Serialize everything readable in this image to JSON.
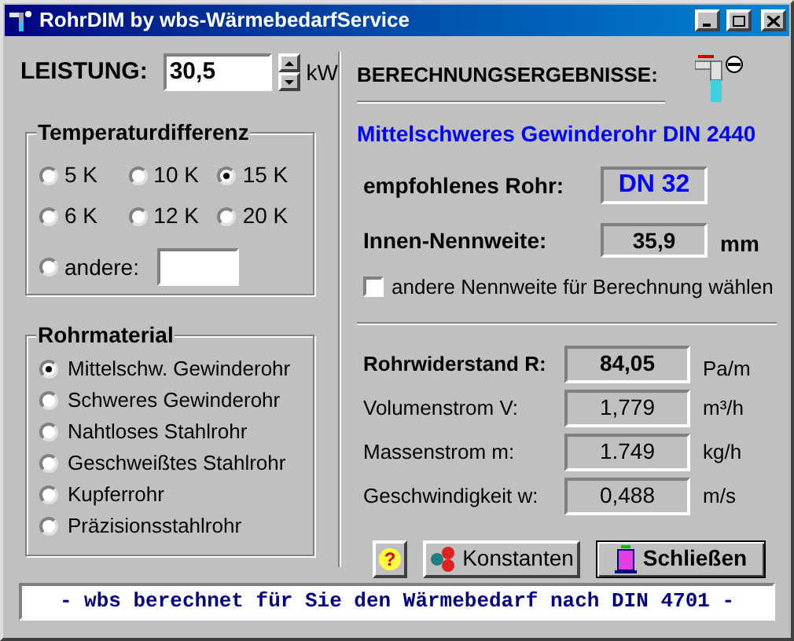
{
  "window": {
    "title": "RohrDIM by wbs-WärmebedarfService"
  },
  "power": {
    "label": "LEISTUNG:",
    "value": "30,5",
    "unit": "kW"
  },
  "temperature": {
    "title": "Temperaturdifferenz",
    "options": [
      {
        "label": "5 K",
        "selected": false
      },
      {
        "label": "10 K",
        "selected": false
      },
      {
        "label": "15 K",
        "selected": true
      },
      {
        "label": "6 K",
        "selected": false
      },
      {
        "label": "12 K",
        "selected": false
      },
      {
        "label": "20 K",
        "selected": false
      }
    ],
    "other": {
      "label": "andere:",
      "selected": false
    }
  },
  "material": {
    "title": "Rohrmaterial",
    "options": [
      {
        "label": "Mittelschw. Gewinderohr",
        "selected": true
      },
      {
        "label": "Schweres Gewinderohr",
        "selected": false
      },
      {
        "label": "Nahtloses Stahlrohr",
        "selected": false
      },
      {
        "label": "Geschweißtes Stahlrohr",
        "selected": false
      },
      {
        "label": "Kupferrohr",
        "selected": false
      },
      {
        "label": "Präzisionsstahlrohr",
        "selected": false
      }
    ]
  },
  "results": {
    "title": "BERECHNUNGSERGEBNISSE:",
    "pipe_type": "Mittelschweres Gewinderohr DIN 2440",
    "recommended": {
      "label": "empfohlenes Rohr:",
      "value": "DN 32"
    },
    "inner": {
      "label": "Innen-Nennweite:",
      "value": "35,9",
      "unit": "mm"
    },
    "other_size": {
      "label": "andere Nennweite für Berechnung wählen",
      "checked": false
    },
    "rows": [
      {
        "kind": "primary",
        "label": "Rohrwiderstand R:",
        "value": "84,05",
        "unit": "Pa/m"
      },
      {
        "kind": "normal",
        "label": "Volumenstrom V:",
        "value": "1,779",
        "unit": "m³/h"
      },
      {
        "kind": "normal",
        "label": "Massenstrom m:",
        "value": "1.749",
        "unit": "kg/h"
      },
      {
        "kind": "normal",
        "label": "Geschwindigkeit w:",
        "value": "0,488",
        "unit": "m/s"
      }
    ]
  },
  "buttons": [
    {
      "kind": "help",
      "label": "?"
    },
    {
      "kind": "constants",
      "label": "Konstanten"
    },
    {
      "kind": "close",
      "label": "Schließen"
    }
  ],
  "banner": "- wbs berechnet für Sie den Wärmebedarf nach DIN 4701 -"
}
